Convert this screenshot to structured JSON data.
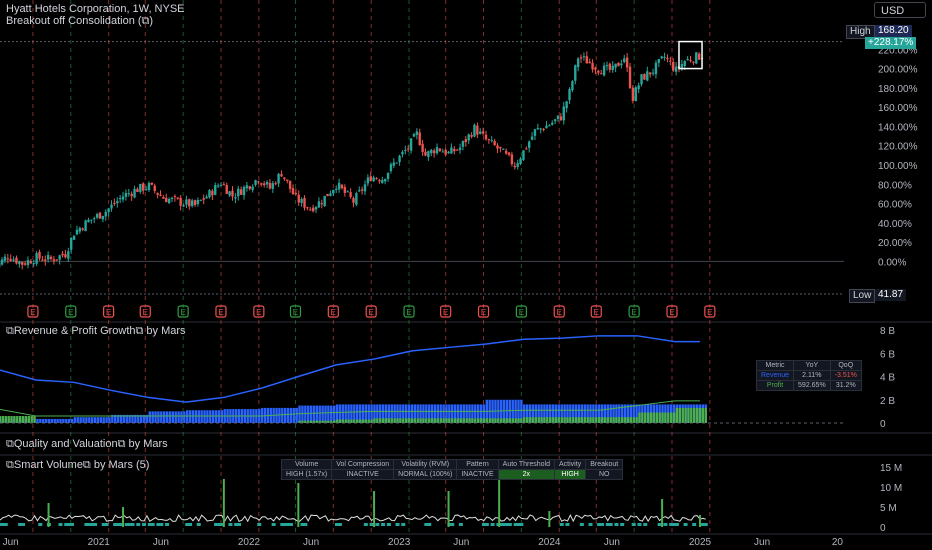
{
  "header": {
    "title": "Hyatt Hotels Corporation, 1W, NYSE",
    "subtitle": "Breakout off Consolidation (⧉)",
    "currency": "USD"
  },
  "price_tags": {
    "high_label": "High",
    "high_value": "168.20",
    "current": "+228.17%",
    "low_label": "Low",
    "low_value": "41.87"
  },
  "colors": {
    "up": "#26a69a",
    "down": "#ef5350",
    "earnings_up": "#2ea043",
    "earnings_down": "#e5484d",
    "revenue": "#2962ff",
    "profit": "#4caf50",
    "volume_line": "#e0e0e0"
  },
  "panes": {
    "rp_title": "⧉Revenue & Profit Growth⧉ by Mars",
    "qv_title": "⧉Quality and Valuation⧉ by Mars",
    "sv_title": "⧉Smart Volume⧉ by Mars (5)"
  },
  "metric_table": {
    "headers": [
      "Metric",
      "YoY",
      "QoQ"
    ],
    "rows": [
      {
        "name": "Revenue",
        "yoy": "2.11%",
        "qoq": "-3.51%"
      },
      {
        "name": "Profit",
        "yoy": "592.65%",
        "qoq": "31.2%"
      }
    ]
  },
  "volume_table": {
    "headers": [
      "Volume",
      "Vol Compression",
      "Volatility (RVM)",
      "Pattern",
      "Auto Threshold",
      "Activity",
      "Breakout"
    ],
    "values": [
      "HIGH (1.57x)",
      "INACTIVE",
      "NORMAL (100%)",
      "INACTIVE",
      "2x",
      "HIGH",
      "NO"
    ]
  },
  "chart_data": [
    {
      "type": "candlestick",
      "title": "Hyatt Hotels Corporation, 1W, NYSE",
      "y_axis_unit": "percent",
      "y_ticks": [
        "0.00%",
        "20.00%",
        "40.00%",
        "60.00%",
        "80.00%",
        "100.00%",
        "120.00%",
        "140.00%",
        "160.00%",
        "180.00%",
        "200.00%",
        "220.00%"
      ],
      "ylim": [
        -40,
        240
      ],
      "x_ticks": [
        "Jun",
        "2021",
        "Jun",
        "2022",
        "Jun",
        "2023",
        "Jun",
        "2024",
        "Jun",
        "2025",
        "Jun",
        "20"
      ],
      "xlim": [
        "2020-05",
        "2026-01"
      ],
      "close_path": [
        [
          "2020-05-04",
          -8
        ],
        [
          "2020-06-08",
          6
        ],
        [
          "2020-07-13",
          -2
        ],
        [
          "2020-08-17",
          4
        ],
        [
          "2020-09-21",
          2
        ],
        [
          "2020-10-26",
          8
        ],
        [
          "2020-11-16",
          30
        ],
        [
          "2020-12-21",
          42
        ],
        [
          "2021-02-01",
          52
        ],
        [
          "2021-03-15",
          68
        ],
        [
          "2021-04-19",
          75
        ],
        [
          "2021-05-17",
          78
        ],
        [
          "2021-06-21",
          66
        ],
        [
          "2021-07-26",
          62
        ],
        [
          "2021-09-06",
          58
        ],
        [
          "2021-10-11",
          70
        ],
        [
          "2021-11-08",
          82
        ],
        [
          "2021-12-06",
          68
        ],
        [
          "2022-01-10",
          78
        ],
        [
          "2022-02-07",
          86
        ],
        [
          "2022-03-07",
          76
        ],
        [
          "2022-04-04",
          92
        ],
        [
          "2022-05-09",
          65
        ],
        [
          "2022-06-13",
          55
        ],
        [
          "2022-07-11",
          63
        ],
        [
          "2022-08-15",
          80
        ],
        [
          "2022-09-26",
          62
        ],
        [
          "2022-11-07",
          88
        ],
        [
          "2022-12-05",
          86
        ],
        [
          "2023-01-09",
          105
        ],
        [
          "2023-02-06",
          118
        ],
        [
          "2023-02-27",
          132
        ],
        [
          "2023-03-20",
          110
        ],
        [
          "2023-04-17",
          118
        ],
        [
          "2023-05-15",
          112
        ],
        [
          "2023-06-12",
          118
        ],
        [
          "2023-07-17",
          138
        ],
        [
          "2023-08-14",
          126
        ],
        [
          "2023-09-18",
          115
        ],
        [
          "2023-10-23",
          100
        ],
        [
          "2023-11-13",
          114
        ],
        [
          "2023-12-11",
          135
        ],
        [
          "2024-01-15",
          142
        ],
        [
          "2024-02-12",
          150
        ],
        [
          "2024-03-04",
          175
        ],
        [
          "2024-03-25",
          212
        ],
        [
          "2024-04-15",
          208
        ],
        [
          "2024-05-13",
          200
        ],
        [
          "2024-06-17",
          198
        ],
        [
          "2024-07-15",
          212
        ],
        [
          "2024-08-05",
          170
        ],
        [
          "2024-08-26",
          190
        ],
        [
          "2024-09-23",
          198
        ],
        [
          "2024-10-21",
          212
        ],
        [
          "2024-11-18",
          198
        ],
        [
          "2024-12-09",
          208
        ],
        [
          "2025-01-06",
          212
        ],
        [
          "2025-01-20",
          214
        ]
      ],
      "earnings_markers_labeled": "E",
      "consolidation_box": {
        "from": "2024-11-25",
        "to": "2025-01-20",
        "low": 200,
        "high": 228
      }
    },
    {
      "type": "area",
      "title": "⧉Revenue & Profit Growth⧉ by Mars",
      "y_ticks": [
        "0",
        "2 B",
        "4 B",
        "6 B",
        "8 B"
      ],
      "ylim": [
        0,
        8
      ],
      "series": [
        {
          "name": "Revenue",
          "values": [
            [
              "2020-05",
              0.35
            ],
            [
              "2020-08",
              0.35
            ],
            [
              "2020-11",
              0.5
            ],
            [
              "2021-02",
              0.7
            ],
            [
              "2021-05",
              1.0
            ],
            [
              "2021-08",
              1.1
            ],
            [
              "2021-11",
              1.2
            ],
            [
              "2022-02",
              1.3
            ],
            [
              "2022-05",
              1.5
            ],
            [
              "2022-08",
              1.6
            ],
            [
              "2022-11",
              1.6
            ],
            [
              "2023-02",
              1.6
            ],
            [
              "2023-05",
              1.6
            ],
            [
              "2023-08",
              2.0
            ],
            [
              "2023-11",
              1.6
            ],
            [
              "2024-02",
              1.6
            ],
            [
              "2024-05",
              1.6
            ],
            [
              "2024-08",
              1.6
            ],
            [
              "2024-11",
              1.6
            ],
            [
              "2025-01",
              1.6
            ]
          ]
        },
        {
          "name": "Profit",
          "values": [
            [
              "2020-05",
              0.6
            ],
            [
              "2020-08",
              0.0
            ],
            [
              "2020-11",
              0.0
            ],
            [
              "2021-02",
              -0.5
            ],
            [
              "2021-05",
              -0.5
            ],
            [
              "2021-08",
              -0.5
            ],
            [
              "2021-11",
              -0.2
            ],
            [
              "2022-02",
              0.0
            ],
            [
              "2022-05",
              0.2
            ],
            [
              "2022-08",
              0.3
            ],
            [
              "2022-11",
              0.4
            ],
            [
              "2023-02",
              0.4
            ],
            [
              "2023-05",
              0.4
            ],
            [
              "2023-08",
              0.4
            ],
            [
              "2023-11",
              0.5
            ],
            [
              "2024-02",
              0.5
            ],
            [
              "2024-05",
              0.5
            ],
            [
              "2024-08",
              0.9
            ],
            [
              "2024-11",
              1.3
            ],
            [
              "2025-01",
              1.3
            ]
          ]
        },
        {
          "name": "Trailing",
          "values": [
            [
              "2020-05",
              4.6
            ],
            [
              "2020-08",
              3.7
            ],
            [
              "2020-11",
              3.5
            ],
            [
              "2021-02",
              2.8
            ],
            [
              "2021-05",
              2.2
            ],
            [
              "2021-08",
              1.8
            ],
            [
              "2021-11",
              2.2
            ],
            [
              "2022-02",
              3.0
            ],
            [
              "2022-05",
              4.0
            ],
            [
              "2022-08",
              5.0
            ],
            [
              "2022-11",
              5.5
            ],
            [
              "2023-02",
              6.2
            ],
            [
              "2023-05",
              6.5
            ],
            [
              "2023-08",
              6.8
            ],
            [
              "2023-11",
              7.2
            ],
            [
              "2024-02",
              7.3
            ],
            [
              "2024-05",
              7.5
            ],
            [
              "2024-08",
              7.5
            ],
            [
              "2024-11",
              7.0
            ],
            [
              "2025-01",
              7.0
            ]
          ]
        }
      ]
    },
    {
      "type": "bar",
      "title": "⧉Smart Volume⧉ by Mars (5)",
      "y_ticks": [
        "0",
        "5 M",
        "10 M",
        "15 M"
      ],
      "ylim": [
        0,
        16
      ],
      "spikes": [
        [
          "2020-09",
          6
        ],
        [
          "2021-03",
          5
        ],
        [
          "2021-11",
          12
        ],
        [
          "2022-05",
          11
        ],
        [
          "2022-11",
          9
        ],
        [
          "2023-05",
          9
        ],
        [
          "2023-09",
          13
        ],
        [
          "2024-01",
          4
        ],
        [
          "2024-10",
          7
        ],
        [
          "2025-01",
          3
        ]
      ]
    }
  ]
}
